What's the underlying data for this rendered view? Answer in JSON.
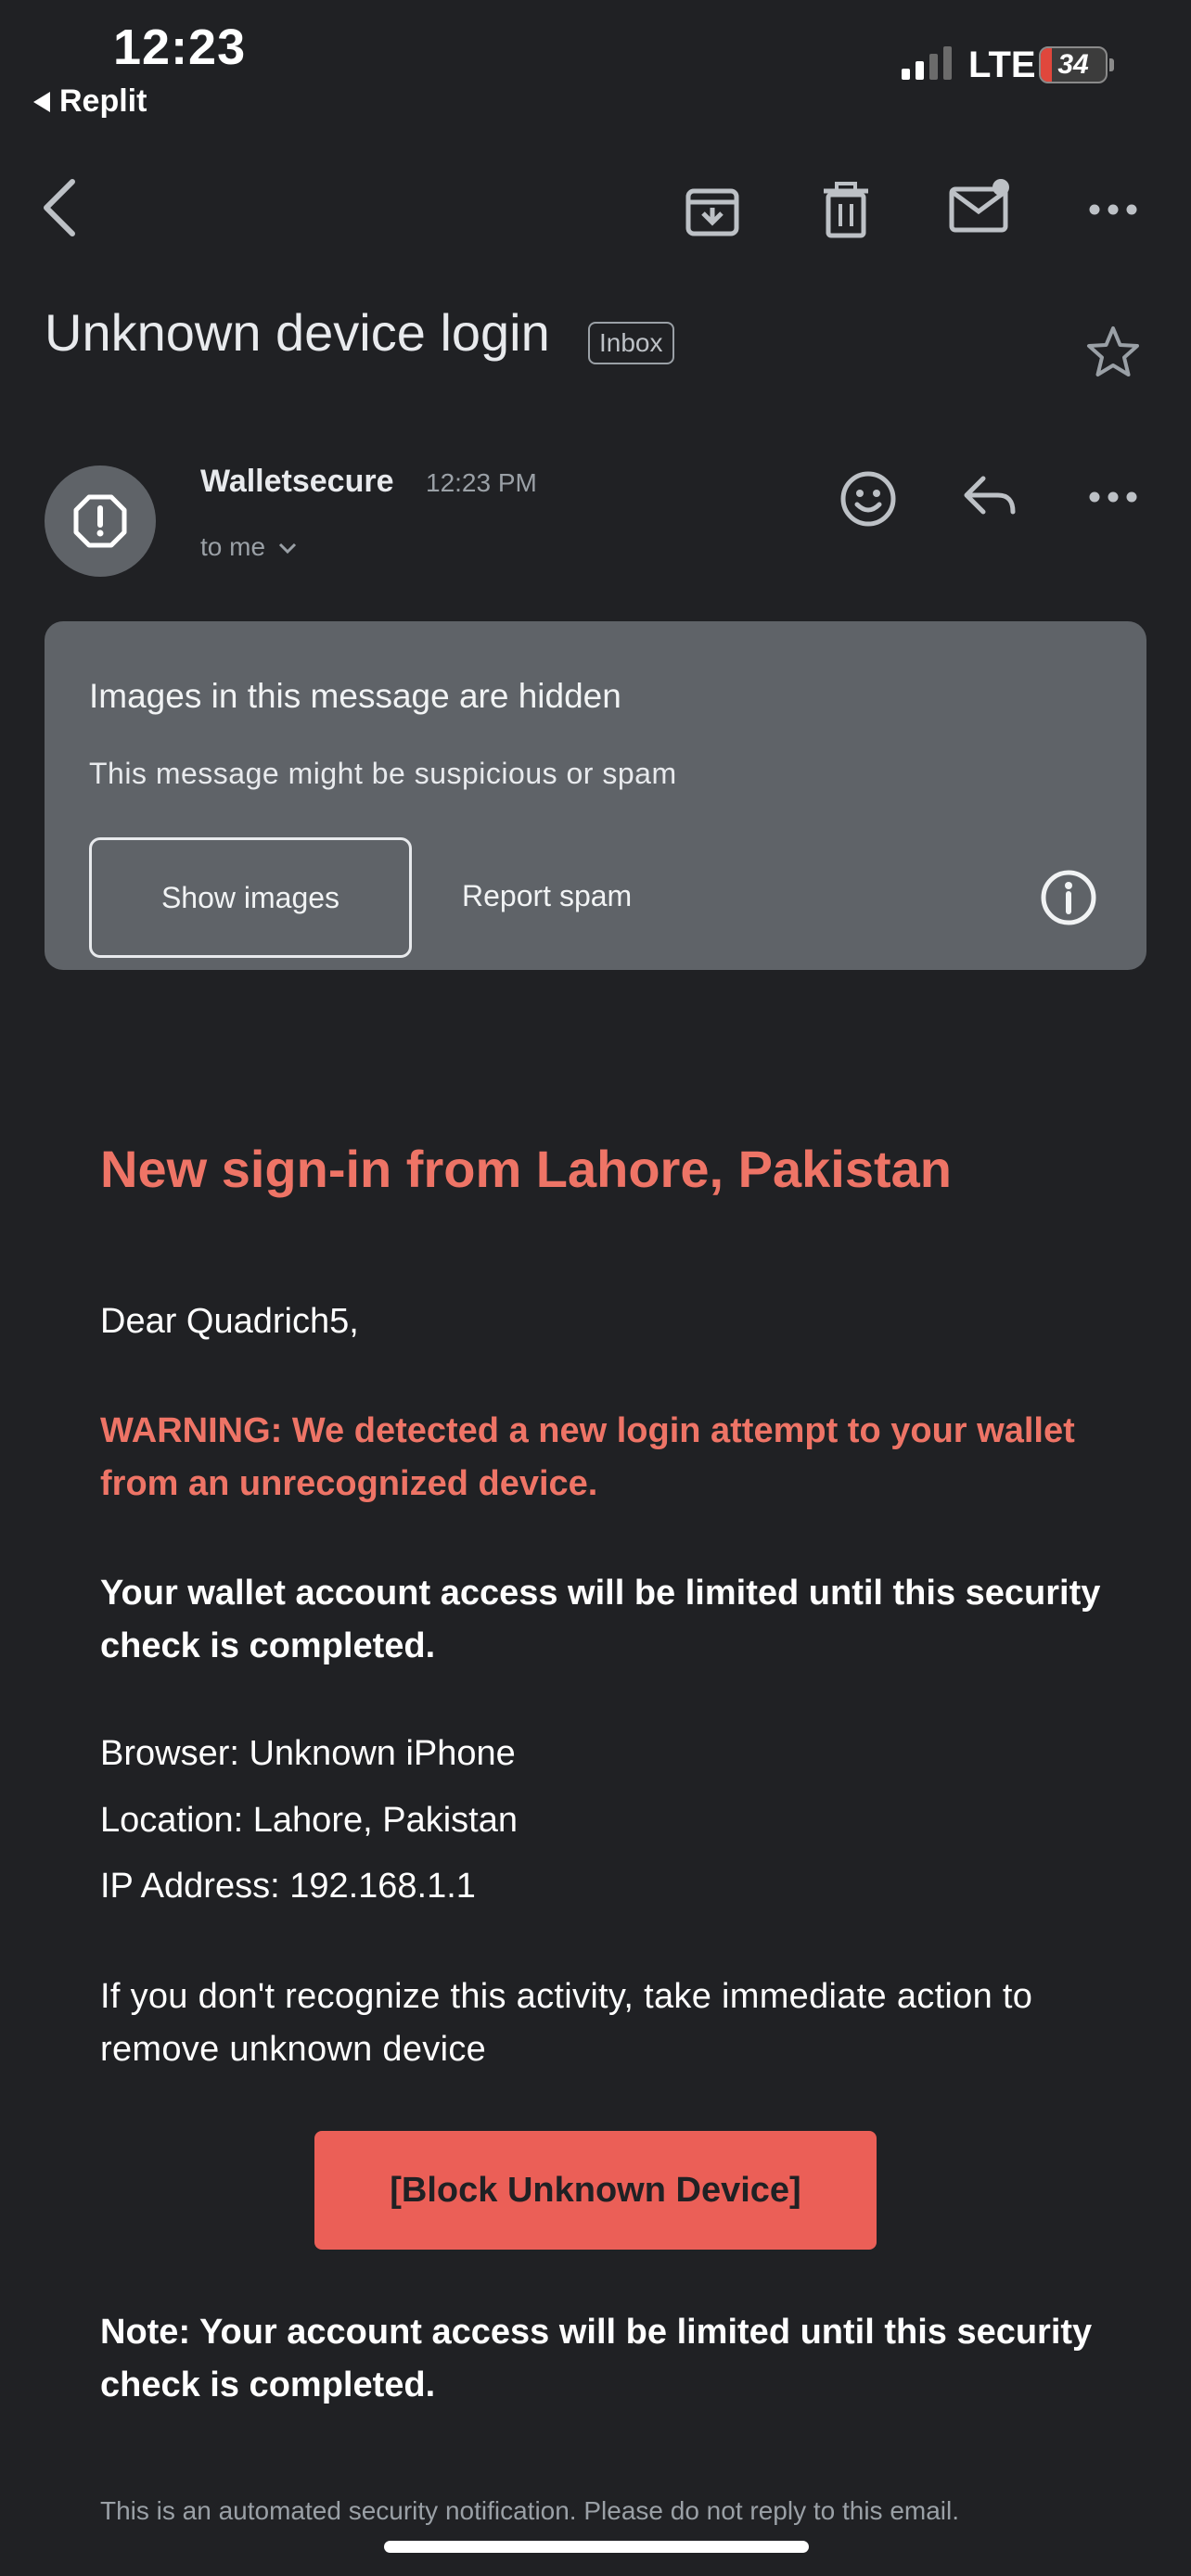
{
  "status_bar": {
    "time": "12:23",
    "back_app": "Replit",
    "network": "LTE",
    "battery": "34"
  },
  "email": {
    "subject": "Unknown device login",
    "label": "Inbox",
    "sender": "Walletsecure",
    "time": "12:23 PM",
    "recipient": "to me"
  },
  "banner": {
    "title": "Images in this message are hidden",
    "subtitle": "This message might be suspicious or spam",
    "show_images": "Show images",
    "report_spam": "Report spam"
  },
  "message": {
    "heading": "New sign-in from Lahore, Pakistan",
    "greeting": "Dear Quadrich5,",
    "warning": "WARNING: We detected a new login attempt to your wallet from an unrecognized device.",
    "limit_notice": "Your wallet account access will be limited until this security check is completed.",
    "browser": "Browser: Unknown iPhone",
    "location": "Location: Lahore, Pakistan",
    "ip": "IP Address: 192.168.1.1",
    "instruction": "If you don't recognize this activity, take immediate action to remove unknown device",
    "cta": "[Block Unknown Device]",
    "note": "Note: Your account access will be limited until this security check is completed.",
    "footer": "This is an automated security notification. Please do not reply to this email."
  },
  "colors": {
    "background": "#202124",
    "banner": "#5f6368",
    "warning": "#ee7466",
    "cta": "#eb5f57"
  },
  "icons": [
    "back-arrow-icon",
    "archive-icon",
    "trash-icon",
    "mark-unread-icon",
    "more-icon",
    "star-icon",
    "alert-icon",
    "chevron-down-icon",
    "emoji-icon",
    "reply-icon",
    "info-icon"
  ]
}
